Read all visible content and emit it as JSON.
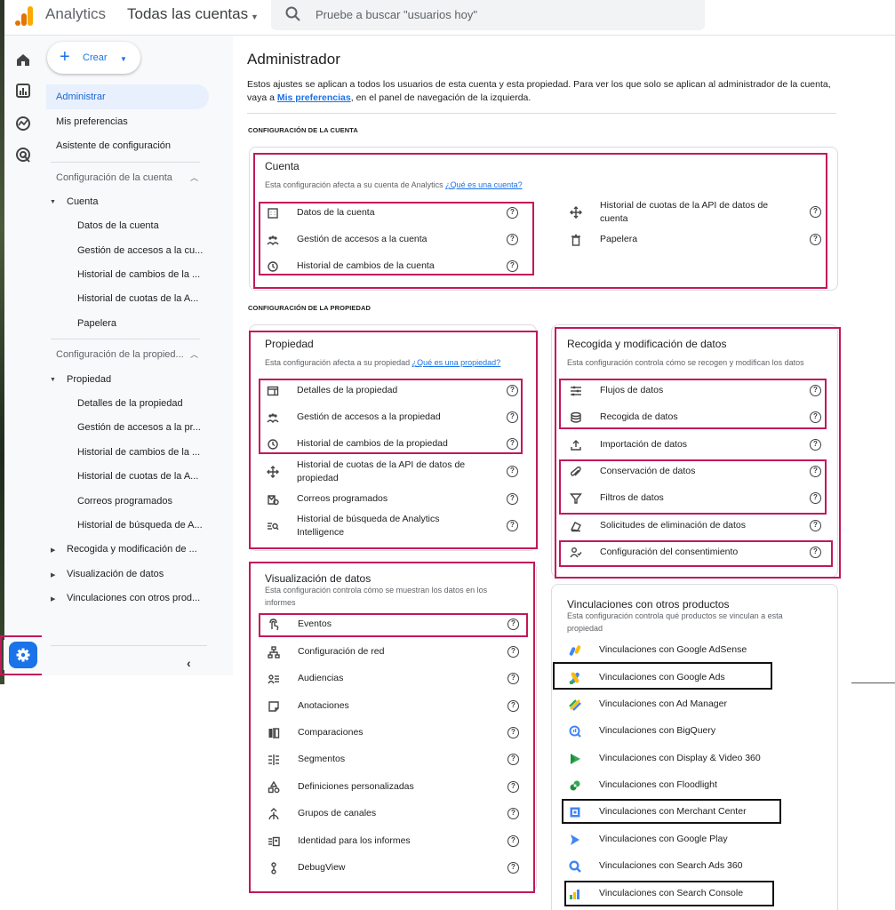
{
  "topbar": {
    "app_name": "Analytics",
    "account": "Todas las cuentas",
    "search_placeholder": "Pruebe a buscar \"usuarios hoy\""
  },
  "sidebar": {
    "create_label": "Crear",
    "items": {
      "admin": "Administrar",
      "prefs": "Mis preferencias",
      "setup": "Asistente de configuración"
    },
    "account_config": {
      "header": "Configuración de la cuenta",
      "group": "Cuenta",
      "items": [
        "Datos de la cuenta",
        "Gestión de accesos a la cu...",
        "Historial de cambios de la ...",
        "Historial de cuotas de la A...",
        "Papelera"
      ]
    },
    "property_config": {
      "header": "Configuración de la propied...",
      "group": "Propiedad",
      "items": [
        "Detalles de la propiedad",
        "Gestión de accesos a la pr...",
        "Historial de cambios de la ...",
        "Historial de cuotas de la A...",
        "Correos programados",
        "Historial de búsqueda de A..."
      ],
      "collapsed_groups": [
        "Recogida y modificación de ...",
        "Visualización de datos",
        "Vinculaciones con otros prod..."
      ]
    }
  },
  "main": {
    "title": "Administrador",
    "intro_1": "Estos ajustes se aplican a todos los usuarios de esta cuenta y esta propiedad. Para ver los que solo se aplican al administrador de la cuenta, vaya a ",
    "intro_link": "Mis preferencias",
    "intro_2": ", en el panel de navegación de la izquierda.",
    "section_account": "CONFIGURACIÓN DE LA CUENTA",
    "section_property": "CONFIGURACIÓN DE LA PROPIEDAD",
    "cuenta": {
      "title": "Cuenta",
      "desc": "Esta configuración afecta a su cuenta de Analytics ",
      "link": "¿Qué es una cuenta?",
      "left": [
        "Datos de la cuenta",
        "Gestión de accesos a la cuenta",
        "Historial de cambios de la cuenta"
      ],
      "right": [
        "Historial de cuotas de la API de datos de cuenta",
        "Papelera"
      ]
    },
    "propiedad": {
      "title": "Propiedad",
      "desc": "Esta configuración afecta a su propiedad ",
      "link": "¿Qué es una propiedad?",
      "items": [
        "Detalles de la propiedad",
        "Gestión de accesos a la propiedad",
        "Historial de cambios de la propiedad",
        "Historial de cuotas de la API de datos de propiedad",
        "Correos programados",
        "Historial de búsqueda de Analytics Intelligence"
      ]
    },
    "recogida": {
      "title": "Recogida y modificación de datos",
      "desc": "Esta configuración controla cómo se recogen y modifican los datos",
      "items": [
        "Flujos de datos",
        "Recogida de datos",
        "Importación de datos",
        "Conservación de datos",
        "Filtros de datos",
        "Solicitudes de eliminación de datos",
        "Configuración del consentimiento"
      ]
    },
    "visualizacion": {
      "title": "Visualización de datos",
      "desc": "Esta configuración controla cómo se muestran los datos en los informes",
      "items": [
        "Eventos",
        "Configuración de red",
        "Audiencias",
        "Anotaciones",
        "Comparaciones",
        "Segmentos",
        "Definiciones personalizadas",
        "Grupos de canales",
        "Identidad para los informes",
        "DebugView"
      ]
    },
    "vinculaciones": {
      "title": "Vinculaciones con otros productos",
      "desc": "Esta configuración controla qué productos se vinculan a esta propiedad",
      "items": [
        "Vinculaciones con Google AdSense",
        "Vinculaciones con Google Ads",
        "Vinculaciones con Ad Manager",
        "Vinculaciones con BigQuery",
        "Vinculaciones con Display & Video 360",
        "Vinculaciones con Floodlight",
        "Vinculaciones con Merchant Center",
        "Vinculaciones con Google Play",
        "Vinculaciones con Search Ads 360",
        "Vinculaciones con Search Console"
      ]
    }
  },
  "colors": {
    "accent": "#1a73e8",
    "highlight": "#c2185b",
    "outline": "#111111"
  }
}
